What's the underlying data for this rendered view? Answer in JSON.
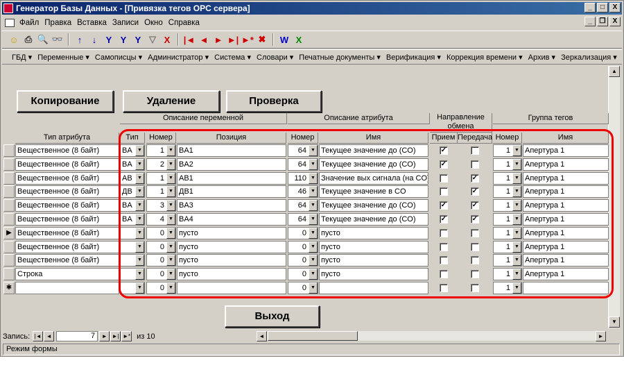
{
  "window": {
    "title": "Генератор Базы Данных - [Привязка тегов OPC сервера]",
    "btn_min": "_",
    "btn_max": "□",
    "btn_close": "X"
  },
  "menu": [
    "Файл",
    "Правка",
    "Вставка",
    "Записи",
    "Окно",
    "Справка"
  ],
  "mdi_buttons": [
    "_",
    "❐",
    "X"
  ],
  "toolbar_icons": [
    "smiley-icon",
    "print-icon",
    "print-preview-icon",
    "find-icon",
    "sort-asc-icon",
    "sort-desc-icon",
    "filter-icon",
    "filter-form-icon",
    "apply-filter-icon",
    "remove-filter-icon",
    "delete-icon",
    "first-icon",
    "prev-icon",
    "next-icon",
    "last-icon",
    "new-record-icon",
    "delete-record-icon",
    "word-icon",
    "excel-icon"
  ],
  "toolbar_glyphs": [
    "☺",
    "⎙",
    "🔍",
    "👓",
    "↑",
    "↓",
    "Y",
    "Y",
    "Y",
    "▽",
    "X",
    "|◄",
    "◄",
    "►",
    "►|",
    "►*",
    "✖",
    "W",
    "X"
  ],
  "toolbar2": [
    "ГБД ▾",
    "Переменные ▾",
    "Самописцы ▾",
    "Администратор ▾",
    "Система ▾",
    "Словари ▾",
    "Печатные документы ▾",
    "Верификация ▾",
    "Коррекция времени ▾",
    "Архив ▾",
    "Зеркализация ▾"
  ],
  "buttons": {
    "copy": "Копирование",
    "delete": "Удаление",
    "check": "Проверка",
    "exit": "Выход"
  },
  "headers": {
    "g_var": "Описание переменной",
    "g_attr": "Описание атрибута",
    "g_dir": "Направление обмена",
    "g_grp": "Группа тегов",
    "attr_type": "Тип атрибута",
    "type": "Тип",
    "num": "Номер",
    "pos": "Позиция",
    "anum": "Номер",
    "aname": "Имя",
    "recv": "Прием",
    "send": "Передача",
    "gnum": "Номер",
    "gname": "Имя"
  },
  "rows": [
    {
      "selector": "",
      "attr_type": "Вещественное (8 байт)",
      "type": "BA",
      "num": "1",
      "pos": "BA1",
      "anum": "64",
      "aname": "Текущее значение до (CO)",
      "recv": true,
      "send": false,
      "gnum": "1",
      "gname": "Апертура 1"
    },
    {
      "selector": "",
      "attr_type": "Вещественное (8 байт)",
      "type": "BA",
      "num": "2",
      "pos": "BA2",
      "anum": "64",
      "aname": "Текущее значение до (CO)",
      "recv": true,
      "send": false,
      "gnum": "1",
      "gname": "Апертура 1"
    },
    {
      "selector": "",
      "attr_type": "Вещественное (8 байт)",
      "type": "AB",
      "num": "1",
      "pos": "AB1",
      "anum": "110",
      "aname": "Значение вых сигнала (на CO)",
      "recv": false,
      "send": true,
      "gnum": "1",
      "gname": "Апертура 1"
    },
    {
      "selector": "",
      "attr_type": "Вещественное (8 байт)",
      "type": "ДВ",
      "num": "1",
      "pos": "ДВ1",
      "anum": "46",
      "aname": "Текущее значение в CO",
      "recv": false,
      "send": true,
      "gnum": "1",
      "gname": "Апертура 1"
    },
    {
      "selector": "",
      "attr_type": "Вещественное (8 байт)",
      "type": "BA",
      "num": "3",
      "pos": "BA3",
      "anum": "64",
      "aname": "Текущее значение до (CO)",
      "recv": true,
      "send": true,
      "gnum": "1",
      "gname": "Апертура 1"
    },
    {
      "selector": "",
      "attr_type": "Вещественное (8 байт)",
      "type": "BA",
      "num": "4",
      "pos": "BA4",
      "anum": "64",
      "aname": "Текущее значение до (CO)",
      "recv": true,
      "send": true,
      "gnum": "1",
      "gname": "Апертура 1"
    },
    {
      "selector": "▶",
      "attr_type": "Вещественное (8 байт)",
      "type": "",
      "num": "0",
      "pos": "пусто",
      "anum": "0",
      "aname": "пусто",
      "recv": false,
      "send": false,
      "gnum": "1",
      "gname": "Апертура 1"
    },
    {
      "selector": "",
      "attr_type": "Вещественное (8 байт)",
      "type": "",
      "num": "0",
      "pos": "пусто",
      "anum": "0",
      "aname": "пусто",
      "recv": false,
      "send": false,
      "gnum": "1",
      "gname": "Апертура 1"
    },
    {
      "selector": "",
      "attr_type": "Вещественное (8 байт)",
      "type": "",
      "num": "0",
      "pos": "пусто",
      "anum": "0",
      "aname": "пусто",
      "recv": false,
      "send": false,
      "gnum": "1",
      "gname": "Апертура 1"
    },
    {
      "selector": "",
      "attr_type": "Строка",
      "type": "",
      "num": "0",
      "pos": "пусто",
      "anum": "0",
      "aname": "пусто",
      "recv": false,
      "send": false,
      "gnum": "1",
      "gname": "Апертура 1"
    },
    {
      "selector": "✱",
      "attr_type": "",
      "type": "",
      "num": "0",
      "pos": "",
      "anum": "0",
      "aname": "",
      "recv": false,
      "send": false,
      "gnum": "1",
      "gname": ""
    }
  ],
  "nav": {
    "label": "Запись:",
    "current": "7",
    "of": "из 10",
    "first": "|◄",
    "prev": "◄",
    "next": "►",
    "last": "►|",
    "new": "►*"
  },
  "status": "Режим формы",
  "accent": "#0a246a",
  "highlight": "#e00000"
}
